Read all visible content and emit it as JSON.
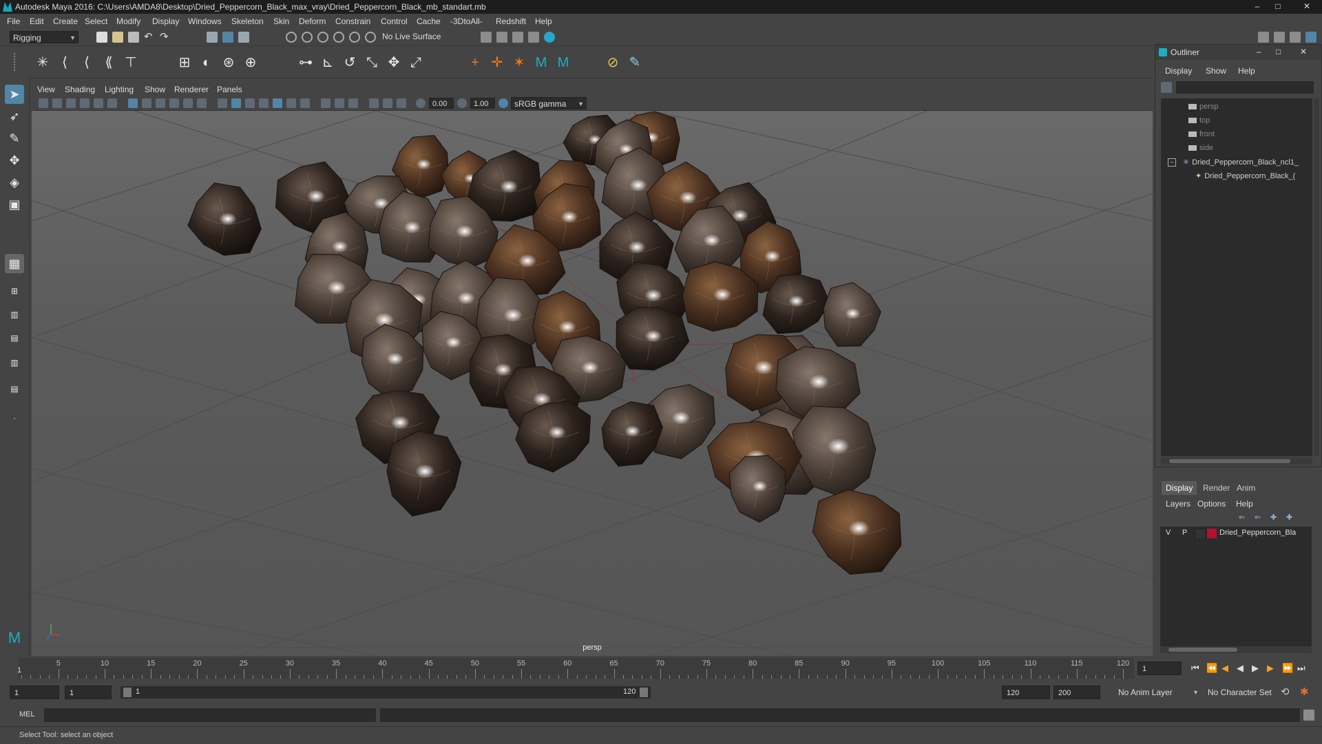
{
  "window": {
    "title": "Autodesk Maya 2016: C:\\Users\\AMDA8\\Desktop\\Dried_Peppercorn_Black_max_vray\\Dried_Peppercorn_Black_mb_standart.mb",
    "minimize": "–",
    "maximize": "□",
    "close": "✕"
  },
  "menubar": [
    "File",
    "Edit",
    "Create",
    "Select",
    "Modify",
    "Display",
    "Windows",
    "Skeleton",
    "Skin",
    "Deform",
    "Constrain",
    "Control",
    "Cache",
    "-3DtoAll-",
    "Redshift",
    "Help"
  ],
  "statusline": {
    "mode": "Rigging",
    "live_surface": "No Live Surface"
  },
  "viewport": {
    "menu": [
      "View",
      "Shading",
      "Lighting",
      "Show",
      "Renderer",
      "Panels"
    ],
    "field_exposure": "0.00",
    "field_gamma": "1.00",
    "color_space": "sRGB gamma",
    "camera": "persp"
  },
  "outliner": {
    "title": "Outliner",
    "menu": [
      "Display",
      "Show",
      "Help"
    ],
    "items": [
      "persp",
      "top",
      "front",
      "side",
      "Dried_Peppercorn_Black_ncl1_",
      "Dried_Peppercorn_Black_("
    ],
    "minimize": "–",
    "maximize": "□",
    "close": "✕"
  },
  "layer_editor": {
    "tabs": [
      "Display",
      "Render",
      "Anim"
    ],
    "menu": [
      "Layers",
      "Options",
      "Help"
    ],
    "layer": {
      "v": "V",
      "p": "P",
      "name": "Dried_Peppercorn_Bla",
      "color": "#b01232"
    }
  },
  "timeslider": {
    "ticks": [
      "5",
      "10",
      "15",
      "20",
      "25",
      "30",
      "35",
      "40",
      "45",
      "50",
      "55",
      "60",
      "65",
      "70",
      "75",
      "80",
      "85",
      "90",
      "95",
      "100",
      "105",
      "110",
      "115",
      "120"
    ],
    "start_label": "1",
    "current_frame": "1"
  },
  "range": {
    "start": "1",
    "playback_start": "1",
    "range_start_label": "1",
    "range_end_label": "120",
    "playback_end": "120",
    "end": "200",
    "anim_layer": "No Anim Layer",
    "character_set": "No Character Set"
  },
  "cmdline": {
    "lang": "MEL"
  },
  "helpline": {
    "text": "Select Tool: select an object"
  },
  "colors": {
    "accent": "#5285a6",
    "bg": "#444444",
    "field": "#2b2b2b"
  },
  "scene_objects": {
    "peppercorn_count": "52"
  }
}
